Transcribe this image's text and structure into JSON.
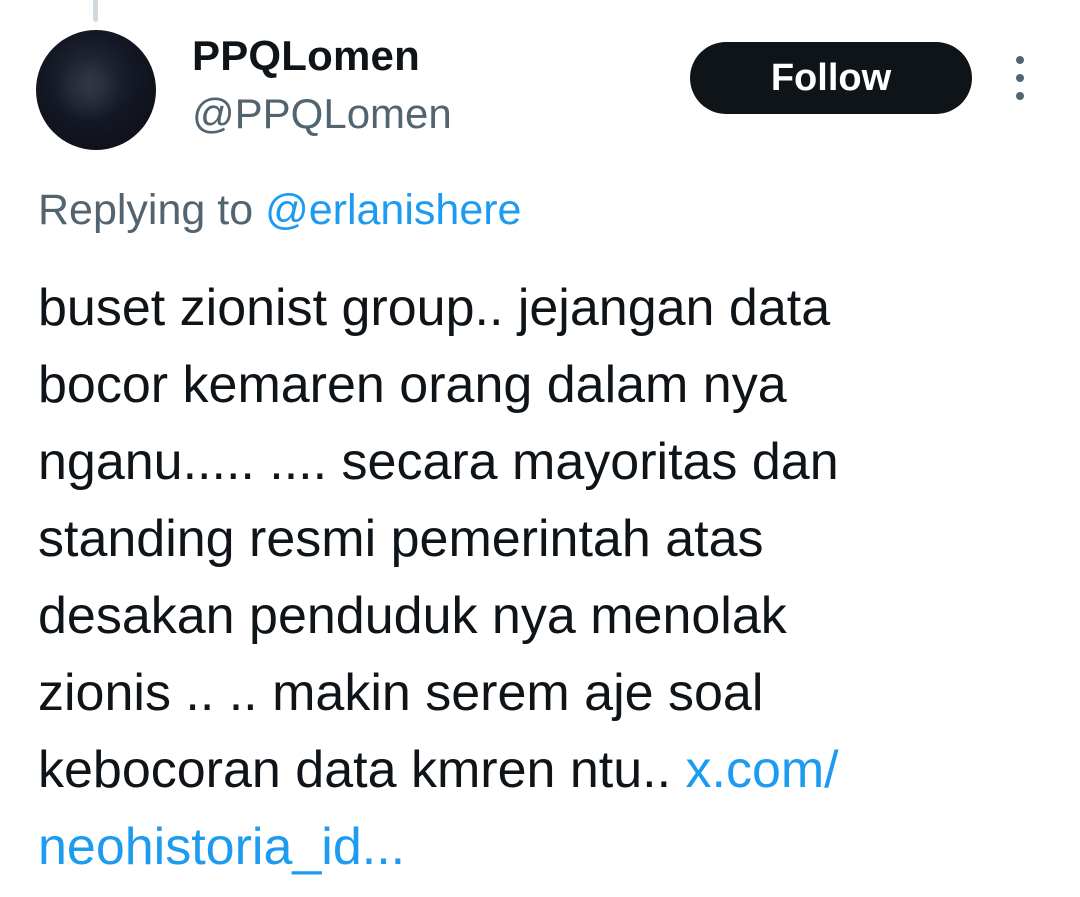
{
  "tweet": {
    "author": {
      "display_name": "PPQLomen",
      "handle": "@PPQLomen"
    },
    "follow_label": "Follow",
    "reply": {
      "prefix": "Replying to ",
      "handle": "@erlanishere"
    },
    "body_lines": [
      "buset zionist group.. jejangan data",
      "bocor kemaren orang dalam nya",
      "nganu..... .... secara mayoritas dan",
      "standing resmi pemerintah atas",
      "desakan penduduk nya menolak",
      "zionis .. .. makin serem aje soal",
      "kebocoran data kmren ntu.. "
    ],
    "link_line1": "x.com/",
    "link_line2": "neohistoria_id..."
  },
  "colors": {
    "text": "#0f1419",
    "secondary": "#536471",
    "link": "#1d9bf0",
    "button_bg": "#0f1419",
    "button_text": "#ffffff"
  },
  "icons": {
    "more": "more-vertical-icon"
  }
}
